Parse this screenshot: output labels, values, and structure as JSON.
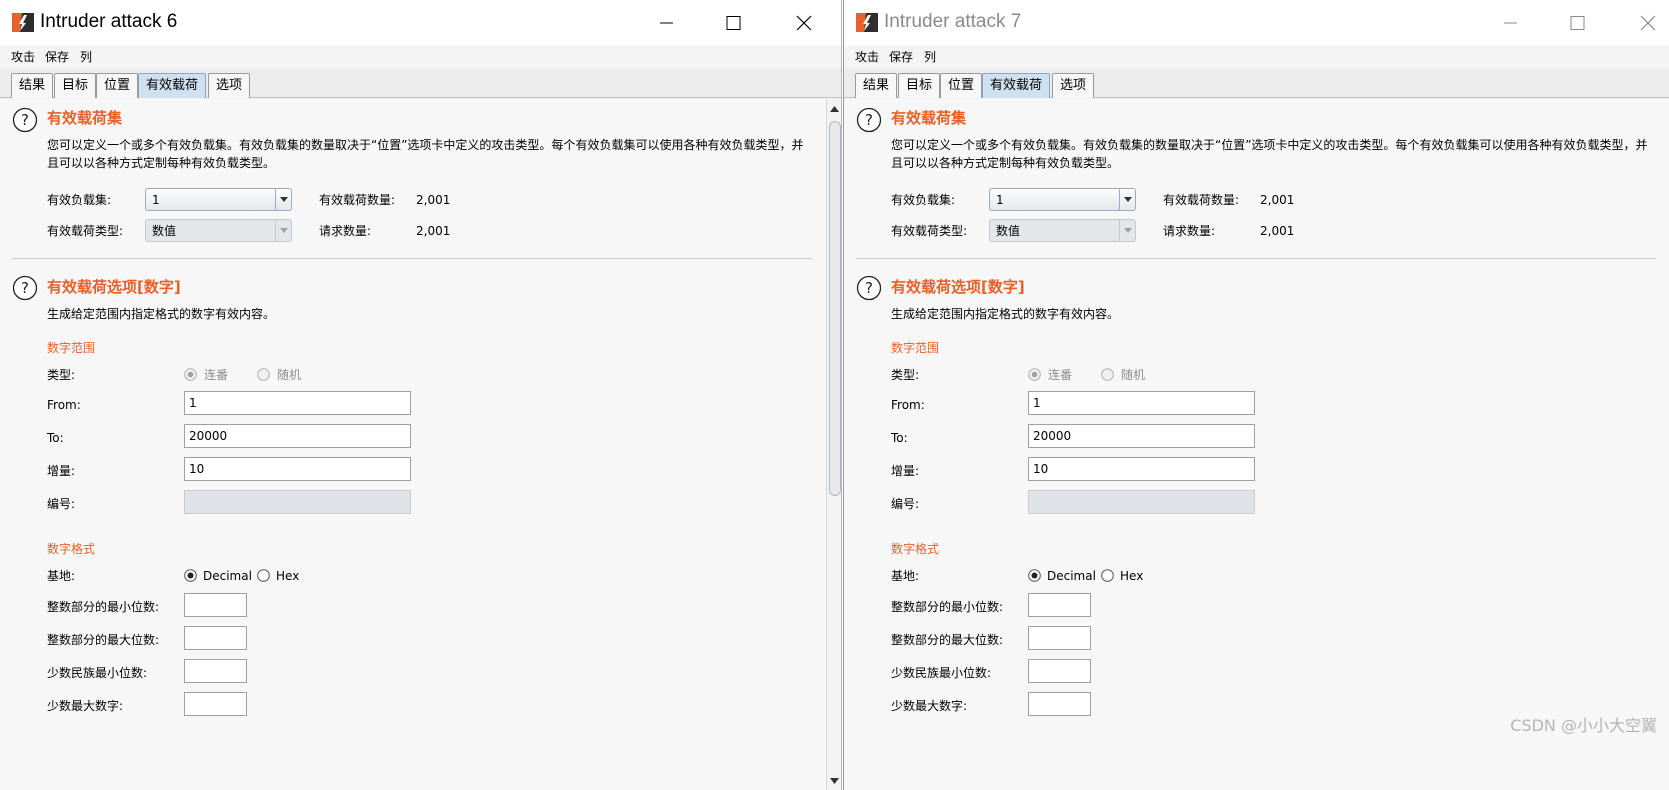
{
  "windows": [
    {
      "id": "win6",
      "title": "Intruder attack 6",
      "menu": [
        "攻击",
        "保存",
        "列"
      ],
      "tabs": [
        {
          "label": "结果",
          "active": false
        },
        {
          "label": "目标",
          "active": false
        },
        {
          "label": "位置",
          "active": false
        },
        {
          "label": "有效载荷",
          "active": true
        },
        {
          "label": "选项",
          "active": false
        }
      ],
      "payload_sets": {
        "title": "有效载荷集",
        "description": "您可以定义一个或多个有效负载集。有效负载集的数量取决于“位置”选项卡中定义的攻击类型。每个有效负载集可以使用各种有效负载类型，并且可以以各种方式定制每种有效负载类型。",
        "set_label": "有效负载集:",
        "set_value": "1",
        "type_label": "有效载荷类型:",
        "type_value": "数值",
        "count_label": "有效载荷数量:",
        "count_value": "2,001",
        "requests_label": "请求数量:",
        "requests_value": "2,001"
      },
      "payload_options": {
        "title": "有效载荷选项[数字]",
        "description": "生成给定范围内指定格式的数字有效内容。",
        "range_title": "数字范围",
        "type_label": "类型:",
        "type_options": [
          "连番",
          "随机"
        ],
        "from_label": "From:",
        "from_value": "1",
        "to_label": "To:",
        "to_value": "20000",
        "step_label": "增量:",
        "step_value": "10",
        "number_label": "编号:",
        "number_value": "",
        "format_title": "数字格式",
        "base_label": "基地:",
        "base_options": [
          "Decimal",
          "Hex"
        ],
        "base_selected": "Decimal",
        "min_int_label": "整数部分的最小位数:",
        "min_int_value": "",
        "max_int_label": "整数部分的最大位数:",
        "max_int_value": "",
        "min_frac_label": "少数民族最小位数:",
        "min_frac_value": "",
        "max_frac_label": "少数最大数字:",
        "max_frac_value": ""
      }
    },
    {
      "id": "win7",
      "title": "Intruder attack 7",
      "menu": [
        "攻击",
        "保存",
        "列"
      ],
      "tabs": [
        {
          "label": "结果",
          "active": false
        },
        {
          "label": "目标",
          "active": false
        },
        {
          "label": "位置",
          "active": false
        },
        {
          "label": "有效载荷",
          "active": true
        },
        {
          "label": "选项",
          "active": false
        }
      ],
      "payload_sets": {
        "title": "有效载荷集",
        "description": "您可以定义一个或多个有效负载集。有效负载集的数量取决于“位置”选项卡中定义的攻击类型。每个有效负载集可以使用各种有效负载类型，并且可以以各种方式定制每种有效负载类型。",
        "set_label": "有效负载集:",
        "set_value": "1",
        "type_label": "有效载荷类型:",
        "type_value": "数值",
        "count_label": "有效载荷数量:",
        "count_value": "2,001",
        "requests_label": "请求数量:",
        "requests_value": "2,001"
      },
      "payload_options": {
        "title": "有效载荷选项[数字]",
        "description": "生成给定范围内指定格式的数字有效内容。",
        "range_title": "数字范围",
        "type_label": "类型:",
        "type_options": [
          "连番",
          "随机"
        ],
        "from_label": "From:",
        "from_value": "1",
        "to_label": "To:",
        "to_value": "20000",
        "step_label": "增量:",
        "step_value": "10",
        "number_label": "编号:",
        "number_value": "",
        "format_title": "数字格式",
        "base_label": "基地:",
        "base_options": [
          "Decimal",
          "Hex"
        ],
        "base_selected": "Decimal",
        "min_int_label": "整数部分的最小位数:",
        "min_int_value": "",
        "max_int_label": "整数部分的最大位数:",
        "max_int_value": "",
        "min_frac_label": "少数民族最小位数:",
        "min_frac_value": "",
        "max_frac_label": "少数最大数字:",
        "max_frac_value": ""
      }
    }
  ],
  "icons": {
    "logo": "burp-logo-icon",
    "minimize": "minimize-icon",
    "maximize": "maximize-icon",
    "close": "close-icon",
    "help": "help-icon",
    "dropdown": "chevron-down-icon"
  },
  "colors": {
    "accent": "#e8602a",
    "active_tab": "#cfe0f0"
  },
  "watermark": "CSDN @小小大空翼"
}
